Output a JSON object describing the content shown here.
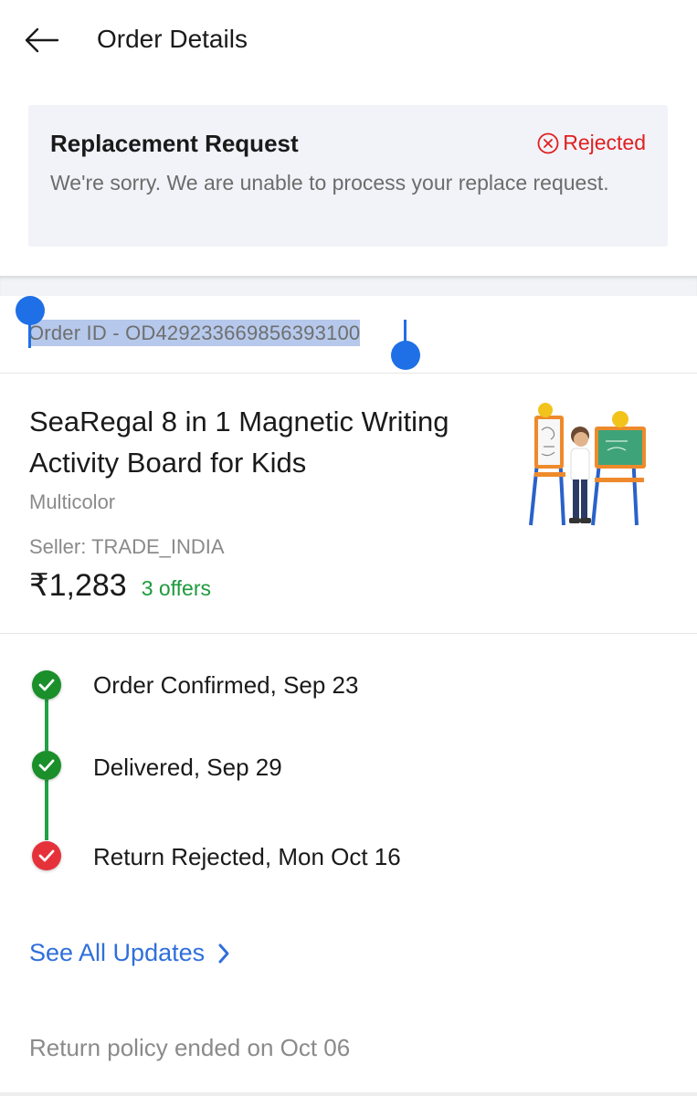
{
  "header": {
    "title": "Order Details",
    "back_icon": "arrow-left-icon"
  },
  "replacement": {
    "title": "Replacement Request",
    "status": "Rejected",
    "status_icon": "circle-x-icon",
    "status_color": "#e02020",
    "message": "We're sorry. We are unable to process your replace request."
  },
  "order": {
    "id_text": "Order ID - OD429233669856393100",
    "selection": "text-selected"
  },
  "product": {
    "name": "SeaRegal 8 in 1 Magnetic Writing Activity Board for Kids",
    "color": "Multicolor",
    "seller": "Seller: TRADE_INDIA",
    "price": "₹1,283",
    "offers": "3 offers",
    "offers_color": "#1d9a3c",
    "image_icon": "product-easel-image"
  },
  "timeline": {
    "steps": [
      {
        "label": "Order Confirmed, Sep 23",
        "status": "done",
        "icon": "check-icon"
      },
      {
        "label": "Delivered, Sep 29",
        "status": "done",
        "icon": "check-icon"
      },
      {
        "label": "Return Rejected, Mon Oct 16",
        "status": "rejected",
        "icon": "check-icon"
      }
    ],
    "done_color": "#1a8f2a",
    "rejected_color": "#e5323a"
  },
  "updates": {
    "link_label": "See All Updates",
    "chevron_icon": "chevron-right-icon"
  },
  "policy": {
    "text": "Return policy ended on Oct 06"
  }
}
